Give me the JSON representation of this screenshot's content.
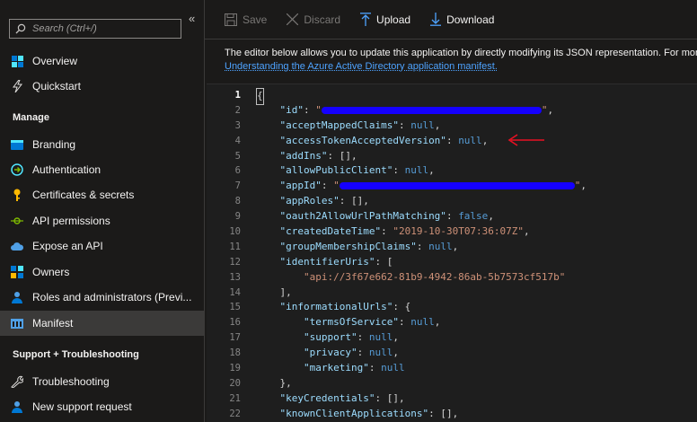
{
  "sidebar": {
    "search_placeholder": "Search (Ctrl+/)",
    "collapse_glyph": "«",
    "items_top": [
      {
        "label": "Overview",
        "icon": "overview-icon"
      },
      {
        "label": "Quickstart",
        "icon": "quickstart-icon"
      }
    ],
    "manage_heading": "Manage",
    "manage_items": [
      {
        "label": "Branding",
        "icon": "branding-icon"
      },
      {
        "label": "Authentication",
        "icon": "authentication-icon"
      },
      {
        "label": "Certificates & secrets",
        "icon": "key-icon"
      },
      {
        "label": "API permissions",
        "icon": "api-permissions-icon"
      },
      {
        "label": "Expose an API",
        "icon": "cloud-icon"
      },
      {
        "label": "Owners",
        "icon": "owners-icon"
      },
      {
        "label": "Roles and administrators (Previ...",
        "icon": "roles-icon"
      },
      {
        "label": "Manifest",
        "icon": "manifest-icon"
      }
    ],
    "support_heading": "Support + Troubleshooting",
    "support_items": [
      {
        "label": "Troubleshooting",
        "icon": "wrench-icon"
      },
      {
        "label": "New support request",
        "icon": "person-icon"
      }
    ],
    "selected": "Manifest"
  },
  "toolbar": {
    "save_label": "Save",
    "discard_label": "Discard",
    "upload_label": "Upload",
    "download_label": "Download"
  },
  "description": {
    "text": "The editor below allows you to update this application by directly modifying its JSON representation. For more details, see",
    "link": "Understanding the Azure Active Directory application manifest."
  },
  "editor": {
    "active_line": 1,
    "line_numbers": [
      "1",
      "2",
      "3",
      "4",
      "5",
      "6",
      "7",
      "8",
      "9",
      "10",
      "11",
      "12",
      "13",
      "14",
      "15",
      "16",
      "17",
      "18",
      "19",
      "20",
      "21",
      "22"
    ],
    "lines": {
      "l1": "{",
      "id_key": "\"id\"",
      "acceptMappedClaims_key": "\"acceptMappedClaims\"",
      "accessTokenAcceptedVersion_key": "\"accessTokenAcceptedVersion\"",
      "addIns_key": "\"addIns\"",
      "allowPublicClient_key": "\"allowPublicClient\"",
      "appId_key": "\"appId\"",
      "appRoles_key": "\"appRoles\"",
      "oauth2AllowUrlPathMatching_key": "\"oauth2AllowUrlPathMatching\"",
      "createdDateTime_key": "\"createdDateTime\"",
      "createdDateTime_val": "\"2019-10-30T07:36:07Z\"",
      "groupMembershipClaims_key": "\"groupMembershipClaims\"",
      "identifierUris_key": "\"identifierUris\"",
      "identifierUri_val": "\"api://3f67e662-81b9-4942-86ab-5b7573cf517b\"",
      "informationalUrls_key": "\"informationalUrls\"",
      "termsOfService_key": "\"termsOfService\"",
      "support_key": "\"support\"",
      "privacy_key": "\"privacy\"",
      "marketing_key": "\"marketing\"",
      "keyCredentials_key": "\"keyCredentials\"",
      "knownClientApplications_key": "\"knownClientApplications\"",
      "null_lit": "null",
      "false_lit": "false"
    }
  },
  "colors": {
    "accent": "#0078d4",
    "annotation_arrow": "#e81123",
    "redaction": "#1500ff"
  }
}
